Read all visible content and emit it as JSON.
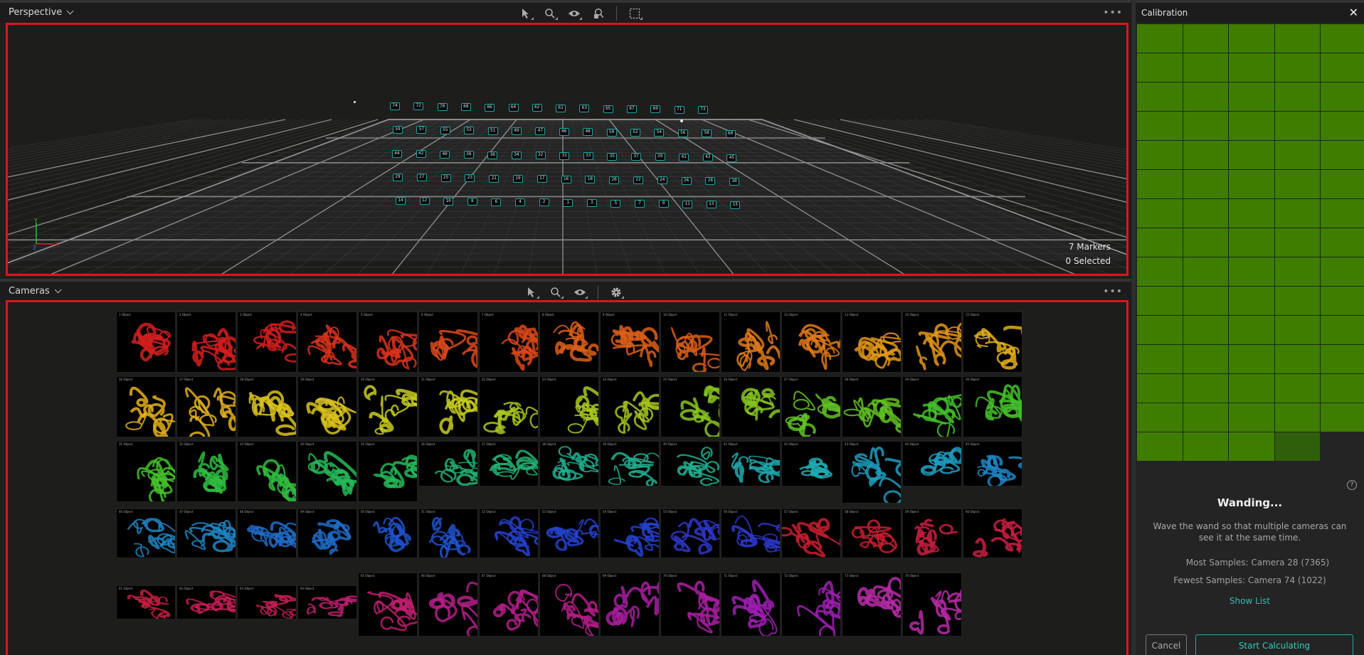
{
  "perspective": {
    "title": "Perspective",
    "toolbar": [
      "select-tool",
      "zoom-tool",
      "view-tool",
      "lock-zoom-tool",
      "marquee-tool"
    ],
    "markers_count": "7 Markers",
    "selected_count": "0 Selected",
    "axis_labels": {
      "x": "X",
      "y": "Y",
      "z": "Z"
    },
    "marker_rows": [
      [
        "74",
        "72",
        "70",
        "68",
        "66",
        "64",
        "62",
        "61",
        "63",
        "65",
        "67",
        "69",
        "71",
        "73"
      ],
      [
        "59",
        "57",
        "55",
        "53",
        "51",
        "49",
        "47",
        "46",
        "48",
        "50",
        "52",
        "54",
        "56",
        "58",
        "60"
      ],
      [
        "44",
        "42",
        "40",
        "38",
        "36",
        "34",
        "32",
        "31",
        "33",
        "35",
        "37",
        "39",
        "41",
        "43",
        "45"
      ],
      [
        "29",
        "27",
        "25",
        "23",
        "21",
        "19",
        "17",
        "16",
        "18",
        "20",
        "22",
        "24",
        "26",
        "28",
        "30"
      ],
      [
        "14",
        "12",
        "10",
        "8",
        "6",
        "4",
        "2",
        "1",
        "3",
        "5",
        "7",
        "9",
        "11",
        "13",
        "15"
      ]
    ]
  },
  "cameras": {
    "title": "Cameras",
    "toolbar": [
      "select-tool",
      "zoom-tool",
      "view-tool",
      "settings-tool"
    ],
    "item_label": "Object",
    "count": 74,
    "colors": [
      "#d41e1e",
      "#d8321c",
      "#d9481a",
      "#dd5e18",
      "#e07a18",
      "#e39618",
      "#e3b01a",
      "#d9c21c",
      "#c8cc1e",
      "#a8c81e",
      "#86c41e",
      "#62c222",
      "#44c02a",
      "#2fbc40",
      "#26b858",
      "#22b474",
      "#20b092",
      "#20aab0",
      "#1e9cc0",
      "#1e86c4",
      "#1e6cc8",
      "#1e52cc",
      "#2442cc",
      "#2e38c8",
      "#c81e2e",
      "#c81e40",
      "#c81e56",
      "#c01e6e",
      "#b41e88",
      "#a81ea0",
      "#9c1eb0",
      "#b82ca8"
    ]
  },
  "calibration": {
    "title": "Calibration",
    "cells_total": 74,
    "low_sample_cells": [
      74
    ],
    "status_title": "Wanding...",
    "status_desc": "Wave the wand so that multiple cameras can see it at the same time.",
    "most_samples_label": "Most Samples:",
    "most_samples_value": "Camera 28 (7365)",
    "fewest_samples_label": "Fewest Samples:",
    "fewest_samples_value": "Camera 74 (1022)",
    "show_list": "Show List",
    "cancel": "Cancel",
    "start": "Start Calculating",
    "help": "?"
  }
}
